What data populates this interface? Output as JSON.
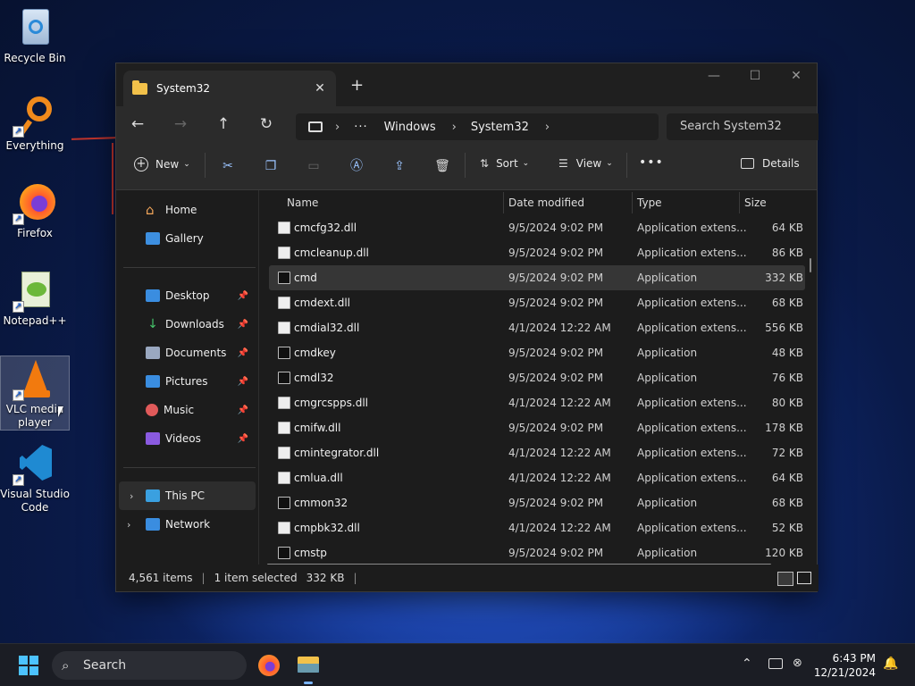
{
  "desktop": {
    "icons": [
      {
        "label": "Recycle Bin",
        "icon": "recycle-bin-icon"
      },
      {
        "label": "Everything",
        "icon": "everything-icon"
      },
      {
        "label": "Firefox",
        "icon": "firefox-icon"
      },
      {
        "label": "Notepad++",
        "icon": "notepadpp-icon"
      },
      {
        "label": "VLC media player",
        "icon": "vlc-icon"
      },
      {
        "label": "Visual Studio Code",
        "icon": "vscode-icon"
      }
    ]
  },
  "explorer": {
    "tab_title": "System32",
    "address": {
      "segments": [
        "Windows",
        "System32"
      ],
      "ellipsis": "···"
    },
    "search_placeholder": "Search System32",
    "toolbar": {
      "new_label": "New",
      "sort_label": "Sort",
      "view_label": "View",
      "details_label": "Details",
      "more": "•••"
    },
    "sidebar": {
      "home": "Home",
      "gallery": "Gallery",
      "quick": [
        "Desktop",
        "Downloads",
        "Documents",
        "Pictures",
        "Music",
        "Videos"
      ],
      "this_pc": "This PC",
      "network": "Network"
    },
    "columns": {
      "name": "Name",
      "date": "Date modified",
      "type": "Type",
      "size": "Size"
    },
    "files": [
      {
        "name": "cmcfg32.dll",
        "date": "9/5/2024 9:02 PM",
        "type": "Application extens...",
        "size": "64 KB",
        "kind": "dll"
      },
      {
        "name": "cmcleanup.dll",
        "date": "9/5/2024 9:02 PM",
        "type": "Application extens...",
        "size": "86 KB",
        "kind": "dll"
      },
      {
        "name": "cmd",
        "date": "9/5/2024 9:02 PM",
        "type": "Application",
        "size": "332 KB",
        "kind": "app",
        "selected": true
      },
      {
        "name": "cmdext.dll",
        "date": "9/5/2024 9:02 PM",
        "type": "Application extens...",
        "size": "68 KB",
        "kind": "dll"
      },
      {
        "name": "cmdial32.dll",
        "date": "4/1/2024 12:22 AM",
        "type": "Application extens...",
        "size": "556 KB",
        "kind": "dll"
      },
      {
        "name": "cmdkey",
        "date": "9/5/2024 9:02 PM",
        "type": "Application",
        "size": "48 KB",
        "kind": "app"
      },
      {
        "name": "cmdl32",
        "date": "9/5/2024 9:02 PM",
        "type": "Application",
        "size": "76 KB",
        "kind": "app"
      },
      {
        "name": "cmgrcspps.dll",
        "date": "4/1/2024 12:22 AM",
        "type": "Application extens...",
        "size": "80 KB",
        "kind": "dll"
      },
      {
        "name": "cmifw.dll",
        "date": "9/5/2024 9:02 PM",
        "type": "Application extens...",
        "size": "178 KB",
        "kind": "dll"
      },
      {
        "name": "cmintegrator.dll",
        "date": "4/1/2024 12:22 AM",
        "type": "Application extens...",
        "size": "72 KB",
        "kind": "dll"
      },
      {
        "name": "cmlua.dll",
        "date": "4/1/2024 12:22 AM",
        "type": "Application extens...",
        "size": "64 KB",
        "kind": "dll"
      },
      {
        "name": "cmmon32",
        "date": "9/5/2024 9:02 PM",
        "type": "Application",
        "size": "68 KB",
        "kind": "app"
      },
      {
        "name": "cmpbk32.dll",
        "date": "4/1/2024 12:22 AM",
        "type": "Application extens...",
        "size": "52 KB",
        "kind": "dll"
      },
      {
        "name": "cmstp",
        "date": "9/5/2024 9:02 PM",
        "type": "Application",
        "size": "120 KB",
        "kind": "app"
      }
    ],
    "status": {
      "items": "4,561 items",
      "selected": "1 item selected",
      "size": "332 KB"
    }
  },
  "taskbar": {
    "search_label": "Search",
    "time": "6:43 PM",
    "date": "12/21/2024"
  },
  "colors": {
    "accent": "#60a5fa",
    "folder": "#f2c14a",
    "window_bg": "#1c1c1c"
  }
}
